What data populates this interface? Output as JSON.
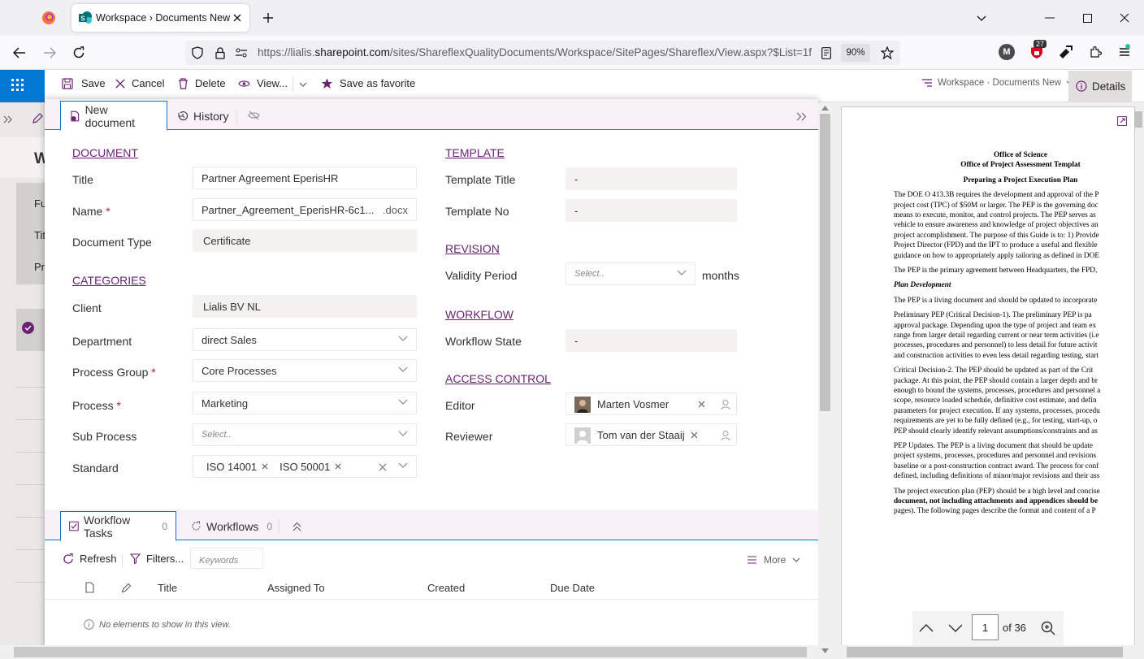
{
  "browser": {
    "tab_title": "Workspace › Documents New",
    "url_prefix": "https://lialis.",
    "url_domain": "sharepoint.com",
    "url_rest": "/sites/ShareflexQualityDocuments/Workspace/SitePages/Shareflex/View.aspx?$List=1f",
    "zoom": "90%",
    "badge_count": "27",
    "profile_letter": "M"
  },
  "toolbar": {
    "save": "Save",
    "cancel": "Cancel",
    "delete": "Delete",
    "view": "View...",
    "favorite": "Save as favorite",
    "breadcrumb": "Workspace · Documents New",
    "details": "Details"
  },
  "left_bg": {
    "letters": [
      "W",
      "Fu",
      "Tit",
      "Pr"
    ]
  },
  "panel_tabs": {
    "new_document": "New document",
    "history": "History"
  },
  "document": {
    "header": "DOCUMENT",
    "title_label": "Title",
    "title_value": "Partner Agreement EperisHR",
    "name_label": "Name",
    "name_value": "Partner_Agreement_EperisHR-6c1...",
    "name_ext": ".docx",
    "doctype_label": "Document Type",
    "doctype_value": "Certificate",
    "required_mark": "*"
  },
  "categories": {
    "header": "CATEGORIES",
    "client_label": "Client",
    "client_value": "Lialis BV NL",
    "department_label": "Department",
    "department_value": "direct Sales",
    "process_group_label": "Process Group",
    "process_group_value": "Core Processes",
    "process_label": "Process",
    "process_value": "Marketing",
    "sub_process_label": "Sub Process",
    "sub_process_placeholder": "Select..",
    "standard_label": "Standard",
    "standards": [
      "ISO 14001",
      "ISO 50001"
    ]
  },
  "template": {
    "header": "TEMPLATE",
    "title_label": "Template Title",
    "title_value": "-",
    "no_label": "Template No",
    "no_value": "-"
  },
  "revision": {
    "header": "REVISION",
    "validity_label": "Validity Period",
    "validity_placeholder": "Select..",
    "unit": "months"
  },
  "workflow": {
    "header": "WORKFLOW",
    "state_label": "Workflow State",
    "state_value": "-"
  },
  "access": {
    "header": "ACCESS CONTROL",
    "editor_label": "Editor",
    "editor_value": "Marten Vosmer",
    "reviewer_label": "Reviewer",
    "reviewer_value": "Tom van der Staaij"
  },
  "lower_tabs": {
    "tasks": "Workflow Tasks",
    "tasks_count": "0",
    "workflows": "Workflows",
    "workflows_count": "0"
  },
  "list_toolbar": {
    "refresh": "Refresh",
    "filters": "Filters...",
    "keywords_placeholder": "Keywords",
    "more": "More"
  },
  "list": {
    "columns": [
      "Title",
      "Assigned To",
      "Created",
      "Due Date"
    ],
    "empty": "No elements to show in this view."
  },
  "preview": {
    "page": "1",
    "of": "of 36",
    "doc_lines": [
      {
        "t": "Office of Science",
        "b": true,
        "c": true
      },
      {
        "t": "Office of Project Assessment Templat",
        "b": true,
        "c": true
      },
      {
        "t": "",
        "b": false
      },
      {
        "t": "Preparing a Project Execution Plan",
        "b": true,
        "c": true
      },
      {
        "t": "",
        "b": false
      },
      {
        "t": "The DOE O 413.3B requires the development and approval of the P",
        "b": false
      },
      {
        "t": "project cost (TPC) of $50M or larger.  The PEP is the governing doc",
        "b": false
      },
      {
        "t": "means to execute, monitor, and control projects.  The PEP serves as",
        "b": false
      },
      {
        "t": "vehicle to ensure awareness and knowledge of project objectives an",
        "b": false
      },
      {
        "t": "project accomplishment.  The purpose of this Guide is to: 1) Provide",
        "b": false
      },
      {
        "t": "Project Director (FPD) and the IPT to produce a useful and flexible",
        "b": false
      },
      {
        "t": "guidance on how to appropriately apply tailoring as defined in DOE",
        "b": false
      },
      {
        "t": "",
        "b": false
      },
      {
        "t": "The PEP is the primary agreement between Headquarters, the FPD,",
        "b": false
      },
      {
        "t": "",
        "b": false
      },
      {
        "t": "Plan Development",
        "b": true,
        "i": true
      },
      {
        "t": "",
        "b": false
      },
      {
        "t": "The PEP is a living  document and should be updated to incorporate",
        "b": false
      },
      {
        "t": "",
        "b": false
      },
      {
        "t": "Preliminary PEP (Critical Decision-1).  The preliminary  PEP is pa",
        "b": false
      },
      {
        "t": "approval package.  Depending upon the type of project and team ex",
        "b": false
      },
      {
        "t": "range from larger detail regarding current or near term activities (i.e",
        "b": false
      },
      {
        "t": "processes, procedures and personnel) to less detail for future activit",
        "b": false
      },
      {
        "t": "and construction activities to even less detail regarding testing, start",
        "b": false
      },
      {
        "t": "",
        "b": false
      },
      {
        "t": "Critical Decision-2.  The PEP should be updated as part of the Crit",
        "b": false
      },
      {
        "t": "package.  At this point, the PEP should contain a larger depth and br",
        "b": false
      },
      {
        "t": "enough to bound the systems, processes, procedures and personnel a",
        "b": false
      },
      {
        "t": "scope, resource loaded schedule, definitive cost estimate, and defin",
        "b": false
      },
      {
        "t": "parameters for project execution.  If any systems, processes, procedu",
        "b": false
      },
      {
        "t": "requirements are yet to be fully defined (e.g., for testing, start-up, o",
        "b": false
      },
      {
        "t": "PEP should clearly identify relevant assumptions/constraints and as",
        "b": false
      },
      {
        "t": "",
        "b": false
      },
      {
        "t": "PEP Updates.  The PEP is a living document that should be update",
        "b": false
      },
      {
        "t": "project systems, processes, procedures and personnel and revisions",
        "b": false
      },
      {
        "t": "baseline or a post-construction contract award.  The process for conf",
        "b": false
      },
      {
        "t": "defined, including definitions of minor/major revisions and their ass",
        "b": false
      },
      {
        "t": "",
        "b": false
      },
      {
        "t": "The project execution plan (PEP) should be a high level and concise",
        "b": false
      },
      {
        "t": "document, not including attachments and appendices should be",
        "b": true
      },
      {
        "t": "pages).  The following pages describe the format and content of a P",
        "b": false
      }
    ]
  },
  "colors": {
    "accent": "#6b2273",
    "sp_blue": "#0078d4",
    "required": "#a4262c"
  }
}
